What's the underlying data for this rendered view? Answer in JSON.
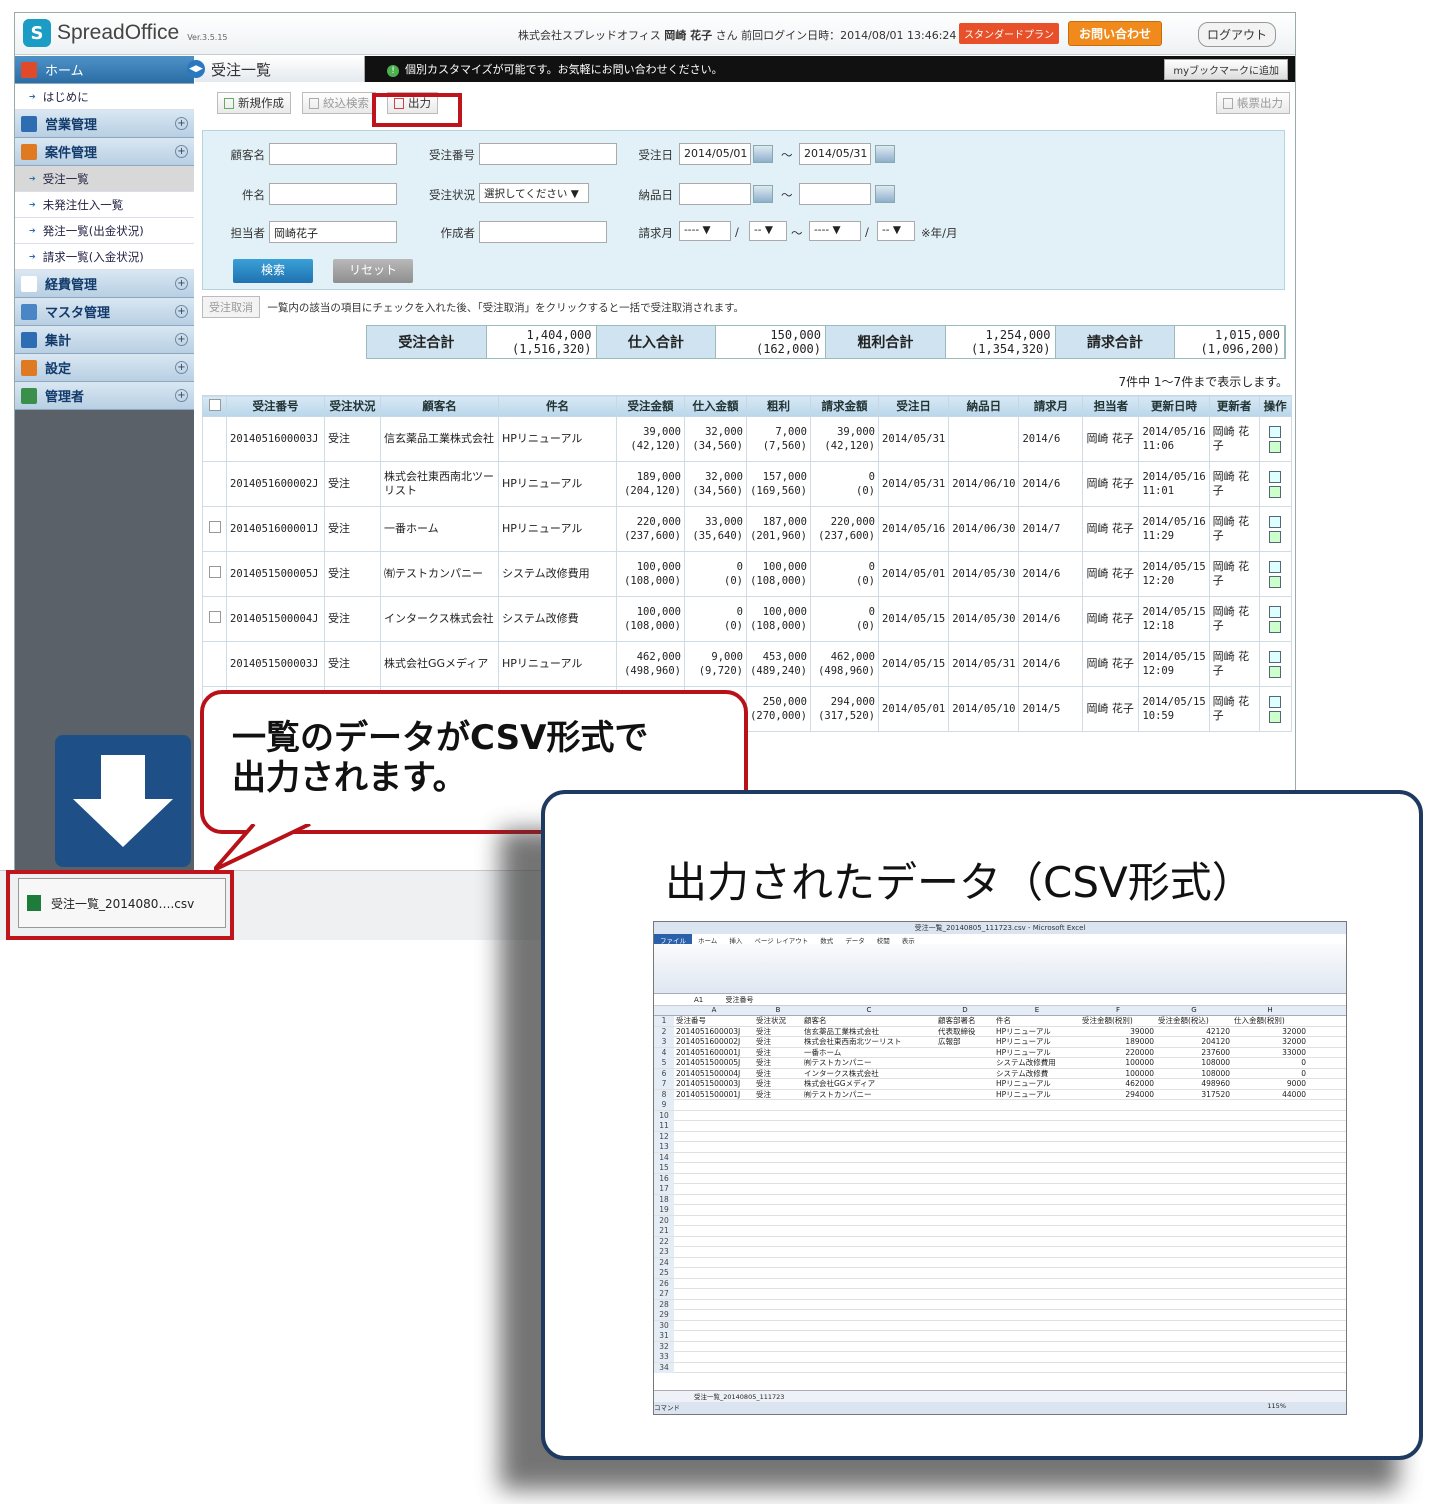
{
  "app": {
    "logo_text": "SpreadOffice",
    "version": "Ver.3.5.15",
    "user_info_prefix": "株式会社スプレッドオフィス",
    "user_name": "岡崎 花子",
    "user_suffix": "さん",
    "last_login": "前回ログイン日時：2014/08/01 13:46:24",
    "plan": "スタンダードプラン",
    "contact": "お問い合わせ",
    "logout": "ログアウト"
  },
  "sidebar": {
    "items": [
      {
        "label": "ホーム",
        "kind": "home"
      },
      {
        "label": "はじめに",
        "kind": "sub"
      },
      {
        "label": "営業管理",
        "kind": "group"
      },
      {
        "label": "案件管理",
        "kind": "group"
      },
      {
        "label": "受注一覧",
        "kind": "sub-active"
      },
      {
        "label": "未発注仕入一覧",
        "kind": "sub"
      },
      {
        "label": "発注一覧(出金状況)",
        "kind": "sub"
      },
      {
        "label": "請求一覧(入金状況)",
        "kind": "sub"
      },
      {
        "label": "経費管理",
        "kind": "group"
      },
      {
        "label": "マスタ管理",
        "kind": "group"
      },
      {
        "label": "集計",
        "kind": "group"
      },
      {
        "label": "設定",
        "kind": "group"
      },
      {
        "label": "管理者",
        "kind": "group"
      }
    ]
  },
  "page": {
    "tab_title": "受注一覧",
    "notice": "個別カスタマイズが可能です。お気軽にお問い合わせください。",
    "bookmark": "myブックマークに追加",
    "toolbar": {
      "new": "新規作成",
      "filter": "絞込検索",
      "export": "出力",
      "report": "帳票出力"
    }
  },
  "search": {
    "customer_label": "顧客名",
    "order_no_label": "受注番号",
    "order_date_label": "受注日",
    "order_date_from": "2014/05/01",
    "order_date_to": "2014/05/31",
    "tilde": "～",
    "subject_label": "件名",
    "status_label": "受注状況",
    "status_value": "選択してください ▼",
    "delivery_label": "納品日",
    "person_label": "担当者",
    "person_value": "岡崎花子",
    "creator_label": "作成者",
    "bill_label": "請求月",
    "bill_year_from": "---- ▼",
    "bill_month_from": "-- ▼",
    "bill_year_to": "---- ▼",
    "bill_month_to": "-- ▼",
    "slash": "/",
    "bill_hint": "※年/月",
    "search_btn": "検索",
    "reset_btn": "リセット"
  },
  "cancel": {
    "button": "受注取消",
    "note": "一覧内の該当の項目にチェックを入れた後、「受注取消」をクリックすると一括で受注取消されます。"
  },
  "totals": [
    {
      "label": "受注合計",
      "value": "1,404,000",
      "sub": "(1,516,320)"
    },
    {
      "label": "仕入合計",
      "value": "150,000",
      "sub": "(162,000)"
    },
    {
      "label": "粗利合計",
      "value": "1,254,000",
      "sub": "(1,354,320)"
    },
    {
      "label": "請求合計",
      "value": "1,015,000",
      "sub": "(1,096,200)"
    }
  ],
  "count_text": "7件中 1～7件まで表示します。",
  "table": {
    "headers": [
      "受注番号",
      "受注状況",
      "顧客名",
      "件名",
      "受注金額",
      "仕入金額",
      "粗利",
      "請求金額",
      "受注日",
      "納品日",
      "請求月",
      "担当者",
      "更新日時",
      "更新者",
      "操作"
    ],
    "rows": [
      {
        "chk": false,
        "no": "2014051600003J",
        "st": "受注",
        "cust": "信玄薬品工業株式会社",
        "subj": "HPリニューアル",
        "amt": "39,000",
        "amt2": "(42,120)",
        "buy": "32,000",
        "buy2": "(34,560)",
        "gp": "7,000",
        "gp2": "(7,560)",
        "bill": "39,000",
        "bill2": "(42,120)",
        "od": "2014/05/31",
        "dd": "",
        "bm": "2014/6",
        "per": "岡崎 花子",
        "upd": "2014/05/16 11:06",
        "upby": "岡崎 花子"
      },
      {
        "chk": false,
        "no": "2014051600002J",
        "st": "受注",
        "cust": "株式会社東西南北ツーリスト",
        "subj": "HPリニューアル",
        "amt": "189,000",
        "amt2": "(204,120)",
        "buy": "32,000",
        "buy2": "(34,560)",
        "gp": "157,000",
        "gp2": "(169,560)",
        "bill": "0",
        "bill2": "(0)",
        "od": "2014/05/31",
        "dd": "2014/06/10",
        "bm": "2014/6",
        "per": "岡崎 花子",
        "upd": "2014/05/16 11:01",
        "upby": "岡崎 花子"
      },
      {
        "chk": true,
        "no": "2014051600001J",
        "st": "受注",
        "cust": "一番ホーム",
        "subj": "HPリニューアル",
        "amt": "220,000",
        "amt2": "(237,600)",
        "buy": "33,000",
        "buy2": "(35,640)",
        "gp": "187,000",
        "gp2": "(201,960)",
        "bill": "220,000",
        "bill2": "(237,600)",
        "od": "2014/05/16",
        "dd": "2014/06/30",
        "bm": "2014/7",
        "per": "岡崎 花子",
        "upd": "2014/05/16 11:29",
        "upby": "岡崎 花子"
      },
      {
        "chk": true,
        "no": "2014051500005J",
        "st": "受注",
        "cust": "㈲テストカンパニー",
        "subj": "システム改修費用",
        "amt": "100,000",
        "amt2": "(108,000)",
        "buy": "0",
        "buy2": "(0)",
        "gp": "100,000",
        "gp2": "(108,000)",
        "bill": "0",
        "bill2": "(0)",
        "od": "2014/05/01",
        "dd": "2014/05/30",
        "bm": "2014/6",
        "per": "岡崎 花子",
        "upd": "2014/05/15 12:20",
        "upby": "岡崎 花子"
      },
      {
        "chk": true,
        "no": "2014051500004J",
        "st": "受注",
        "cust": "インタークス株式会社",
        "subj": "システム改修費",
        "amt": "100,000",
        "amt2": "(108,000)",
        "buy": "0",
        "buy2": "(0)",
        "gp": "100,000",
        "gp2": "(108,000)",
        "bill": "0",
        "bill2": "(0)",
        "od": "2014/05/15",
        "dd": "2014/05/30",
        "bm": "2014/6",
        "per": "岡崎 花子",
        "upd": "2014/05/15 12:18",
        "upby": "岡崎 花子"
      },
      {
        "chk": false,
        "no": "2014051500003J",
        "st": "受注",
        "cust": "株式会社GGメディア",
        "subj": "HPリニューアル",
        "amt": "462,000",
        "amt2": "(498,960)",
        "buy": "9,000",
        "buy2": "(9,720)",
        "gp": "453,000",
        "gp2": "(489,240)",
        "bill": "462,000",
        "bill2": "(498,960)",
        "od": "2014/05/15",
        "dd": "2014/05/31",
        "bm": "2014/6",
        "per": "岡崎 花子",
        "upd": "2014/05/15 12:09",
        "upby": "岡崎 花子"
      },
      {
        "chk": false,
        "no": "",
        "st": "",
        "cust": "",
        "subj": "",
        "amt": "",
        "amt2": "",
        "buy": "",
        "buy2": "",
        "gp": "250,000",
        "gp2": "(270,000)",
        "bill": "294,000",
        "bill2": "(317,520)",
        "od": "2014/05/01",
        "dd": "2014/05/10",
        "bm": "2014/5",
        "per": "岡崎 花子",
        "upd": "2014/05/15 10:59",
        "upby": "岡崎 花子"
      }
    ]
  },
  "download": {
    "file": "受注一覧_2014080….csv",
    "bookmark_bar": "myブックマーク"
  },
  "callout": {
    "line1": "一覧のデータがCSV形式で",
    "line2": "出力されます。"
  },
  "panel": {
    "title": "出力されたデータ（CSV形式）",
    "excel": {
      "window_title": "受注一覧_20140805_111723.csv - Microsoft Excel",
      "tabs": [
        "ファイル",
        "ホーム",
        "挿入",
        "ページ レイアウト",
        "数式",
        "データ",
        "校閲",
        "表示"
      ],
      "name_box": "A1",
      "formula": "受注番号",
      "columns": [
        "A",
        "B",
        "C",
        "D",
        "E",
        "F",
        "G",
        "H"
      ],
      "header_row": [
        "受注番号",
        "受注状況",
        "顧客名",
        "顧客部署名",
        "件名",
        "受注金額(税別)",
        "受注金額(税込)",
        "仕入金額(税別)",
        "仕入金"
      ],
      "rows": [
        [
          "2014051600003J",
          "受注",
          "信玄薬品工業株式会社",
          "代表取締役",
          "HPリニューアル",
          "39000",
          "42120",
          "32000"
        ],
        [
          "2014051600002J",
          "受注",
          "株式会社東西南北ツーリスト",
          "広報部",
          "HPリニューアル",
          "189000",
          "204120",
          "32000"
        ],
        [
          "2014051600001J",
          "受注",
          "一番ホーム",
          "",
          "HPリニューアル",
          "220000",
          "237600",
          "33000"
        ],
        [
          "2014051500005J",
          "受注",
          "㈲テストカンパニー",
          "",
          "システム改修費用",
          "100000",
          "108000",
          "0"
        ],
        [
          "2014051500004J",
          "受注",
          "インタークス株式会社",
          "",
          "システム改修費",
          "100000",
          "108000",
          "0"
        ],
        [
          "2014051500003J",
          "受注",
          "株式会社GGメディア",
          "",
          "HPリニューアル",
          "462000",
          "498960",
          "9000"
        ],
        [
          "2014051500001J",
          "受注",
          "㈲テストカンパニー",
          "",
          "HPリニューアル",
          "294000",
          "317520",
          "44000"
        ]
      ],
      "sheet_tab": "受注一覧_20140805_111723",
      "status": "コマンド",
      "zoom": "115%"
    }
  }
}
